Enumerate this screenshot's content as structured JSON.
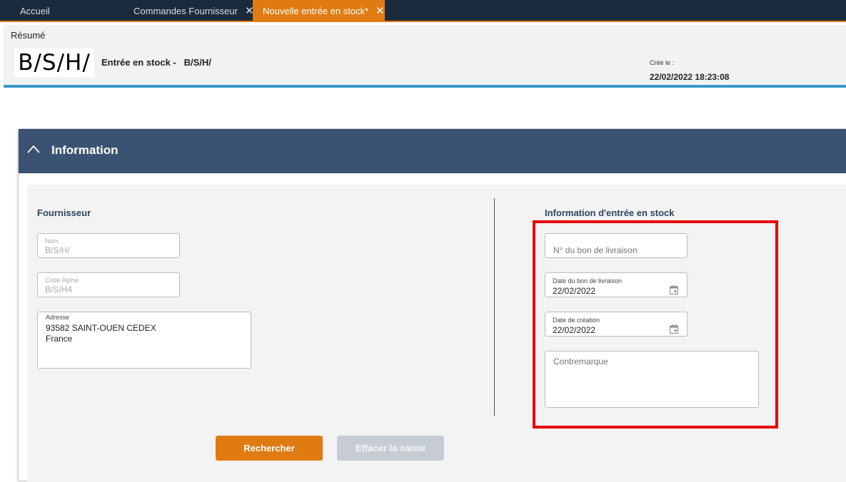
{
  "tabs": [
    {
      "label": "Accueil",
      "closable": false,
      "active": false
    },
    {
      "label": "Commandes Fournisseur",
      "closable": true,
      "active": false
    },
    {
      "label": "Nouvelle entrée en stock*",
      "closable": true,
      "active": true
    }
  ],
  "tab_close_glyph": "✕",
  "resume": {
    "title": "Résumé",
    "logo_text": "B/S/H/",
    "entry_label": "Entrée en stock -",
    "entry_supplier": "B/S/H/",
    "created_label": "Créé le :",
    "created_value": "22/02/2022 18:23:08"
  },
  "panel": {
    "title": "Information",
    "collapse_icon": "chevron-up-icon"
  },
  "supplier": {
    "section_title": "Fournisseur",
    "name": {
      "label": "Nom",
      "value": "B/S/H/"
    },
    "alpha_code": {
      "label": "Code Alpha",
      "value": "B/S/H4"
    },
    "address": {
      "label": "Adresse",
      "lines": [
        "93582 SAINT-OUEN CEDEX",
        "France"
      ]
    }
  },
  "stock_entry": {
    "section_title": "Information d'entrée en stock",
    "delivery_note_number": {
      "placeholder": "N° du bon de livraison"
    },
    "delivery_note_date": {
      "label": "Date du bon de livraison",
      "value": "22/02/2022",
      "icon": "calendar-icon"
    },
    "creation_date": {
      "label": "Date de création",
      "value": "22/02/2022",
      "icon": "calendar-icon"
    },
    "counter_mark": {
      "placeholder": "Contremarque"
    }
  },
  "buttons": {
    "search": "Rechercher",
    "clear": "Effacer la saisie"
  },
  "colors": {
    "tabbar": "#1b2a3c",
    "accent_orange": "#e07b12",
    "panel_header": "#3a5372",
    "resume_underline": "#3c9ac9",
    "highlight_red": "#e60000",
    "disabled_button": "#c5ccd3"
  }
}
